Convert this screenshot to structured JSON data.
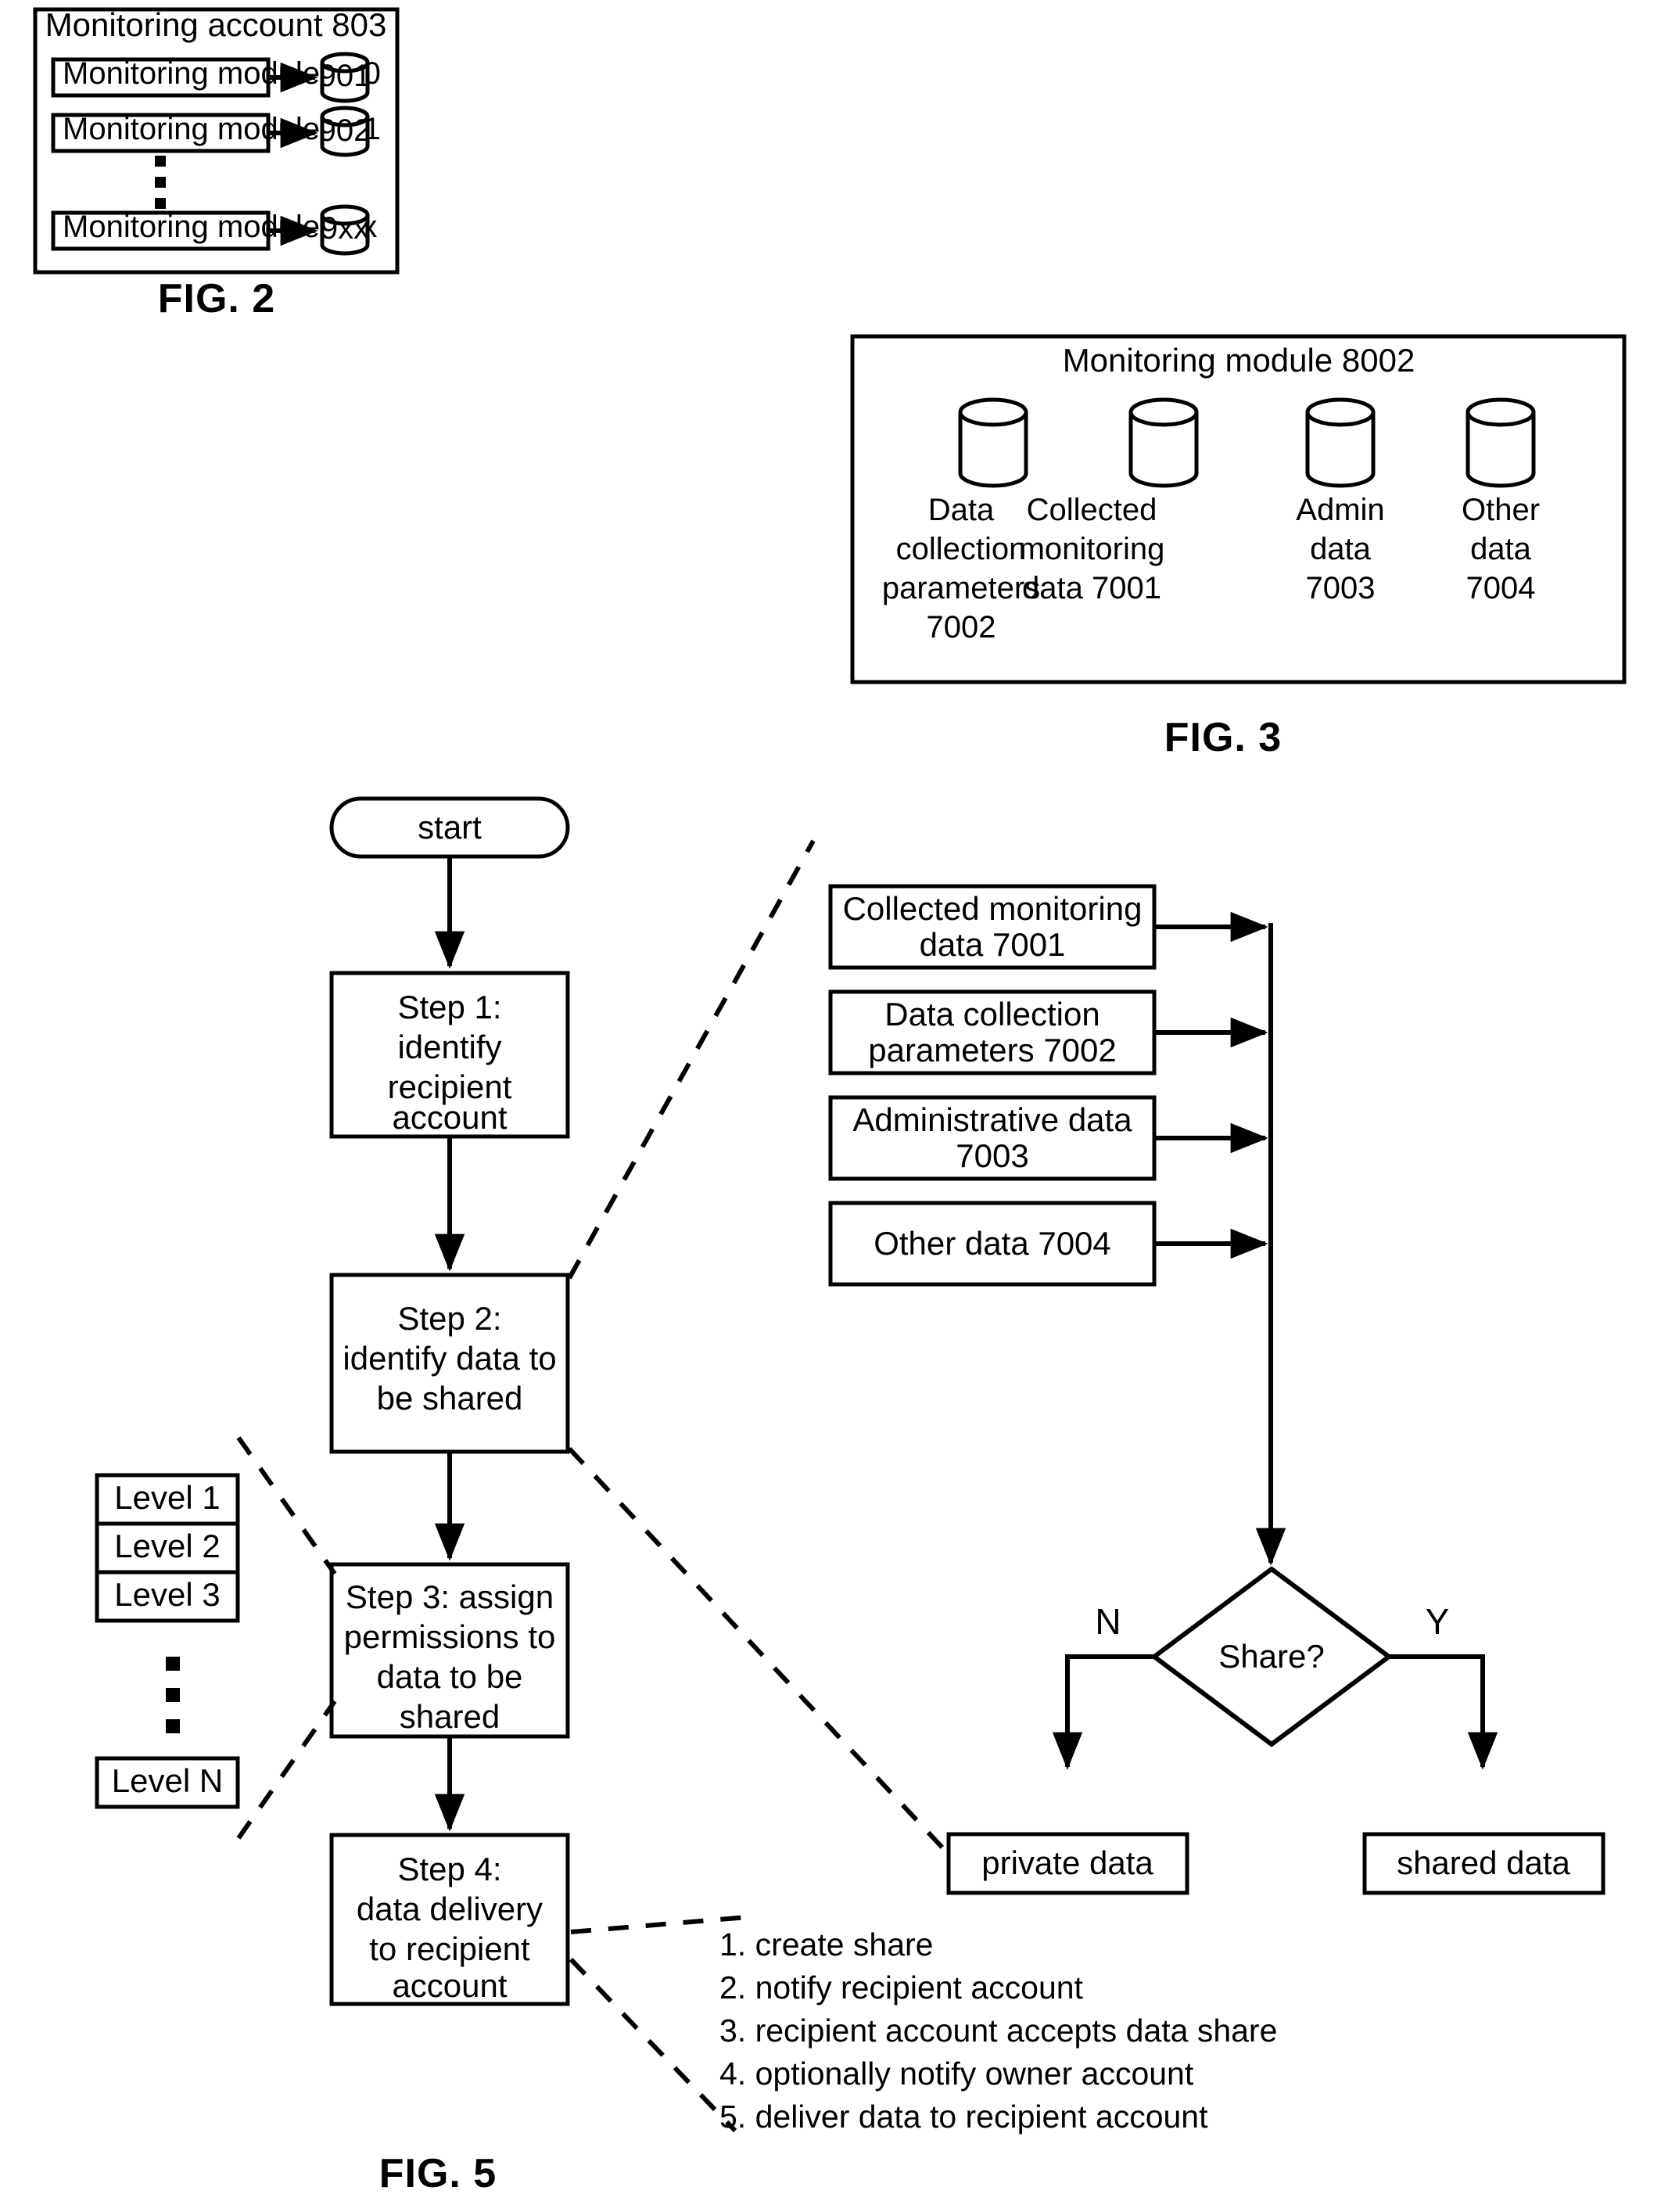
{
  "figures": {
    "fig2": {
      "caption": "FIG. 2",
      "container_title": "Monitoring account 803",
      "modules": [
        {
          "label": "Monitoring module 700",
          "store": "901"
        },
        {
          "label": "Monitoring module 701",
          "store": "902"
        },
        {
          "label": "Monitoring module 7xx",
          "store": "9xx"
        }
      ],
      "ellipsis": "vertical-dots"
    },
    "fig3": {
      "caption": "FIG. 3",
      "container_title": "Monitoring module 8002",
      "stores": [
        {
          "line1": "Data",
          "line2": "collection",
          "line3": "parameters",
          "line4": "7002"
        },
        {
          "line1": "Collected",
          "line2": "monitoring",
          "line3": "data 7001",
          "line4": ""
        },
        {
          "line1": "Admin",
          "line2": "data",
          "line3": "7003",
          "line4": ""
        },
        {
          "line1": "Other",
          "line2": "data",
          "line3": "7004",
          "line4": ""
        }
      ]
    },
    "fig5": {
      "caption": "FIG. 5",
      "start_label": "start",
      "steps": [
        {
          "lines": [
            "Step 1:",
            "identify",
            "recipient",
            "account"
          ]
        },
        {
          "lines": [
            "Step 2:",
            "identify data to",
            "be shared"
          ]
        },
        {
          "lines": [
            "Step 3: assign",
            "permissions to",
            "data to be",
            "shared"
          ]
        },
        {
          "lines": [
            "Step 4:",
            "data delivery",
            "to recipient",
            "account"
          ]
        }
      ],
      "levels": [
        "Level 1",
        "Level 2",
        "Level 3",
        "Level N"
      ],
      "levels_ellipsis": "vertical-dots",
      "data_boxes": [
        {
          "lines": [
            "Collected monitoring",
            "data 7001"
          ]
        },
        {
          "lines": [
            "Data collection",
            "parameters 7002"
          ]
        },
        {
          "lines": [
            "Administrative data",
            "7003"
          ]
        },
        {
          "lines": [
            "Other data 7004"
          ]
        }
      ],
      "decision": {
        "label": "Share?",
        "no_label": "N",
        "yes_label": "Y"
      },
      "outcomes": [
        {
          "label": "private data"
        },
        {
          "label": "shared data"
        }
      ],
      "delivery_substeps": [
        "1. create share",
        "2. notify recipient account",
        "3. recipient account accepts data share",
        "4. optionally notify owner account",
        "5. deliver data to recipient account"
      ]
    }
  },
  "colors": {
    "ink": "#000000",
    "paper": "#ffffff"
  }
}
